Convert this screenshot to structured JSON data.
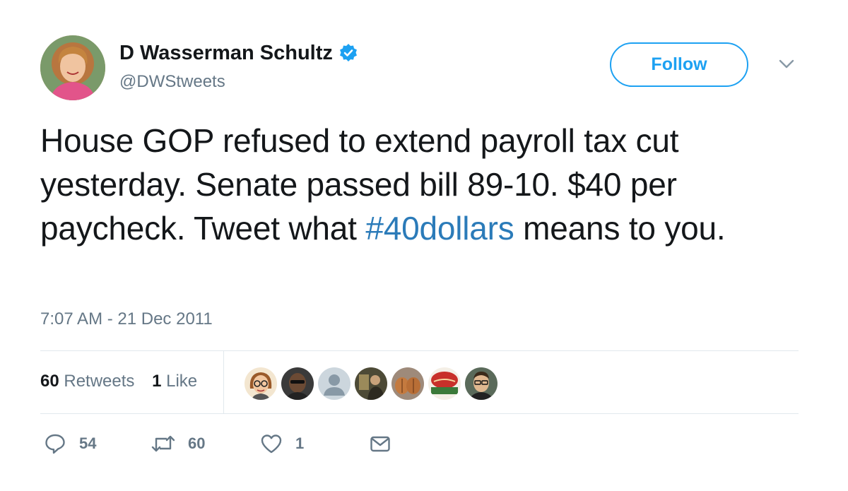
{
  "author": {
    "display_name": "D Wasserman Schultz",
    "handle": "@DWStweets",
    "verified": true
  },
  "header": {
    "follow_label": "Follow"
  },
  "tweet": {
    "text_before": "House GOP refused to extend payroll tax cut yesterday. Senate passed bill 89-10. $40 per paycheck. Tweet what ",
    "hashtag": "#40dollars",
    "text_after": " means to you.",
    "timestamp": "7:07 AM - 21 Dec 2011"
  },
  "stats": {
    "retweets_count": "60",
    "retweets_label": "Retweets",
    "likes_count": "1",
    "likes_label": "Like"
  },
  "liker_avatars": [
    "liker-1",
    "liker-2",
    "liker-3",
    "liker-4",
    "liker-5",
    "liker-6",
    "liker-7"
  ],
  "actions": {
    "replies": "54",
    "retweets": "60",
    "likes": "1"
  },
  "colors": {
    "accent": "#1da1f2",
    "hashtag": "#2b7bb9",
    "secondary_text": "#657786",
    "divider": "#e1e8ed"
  }
}
